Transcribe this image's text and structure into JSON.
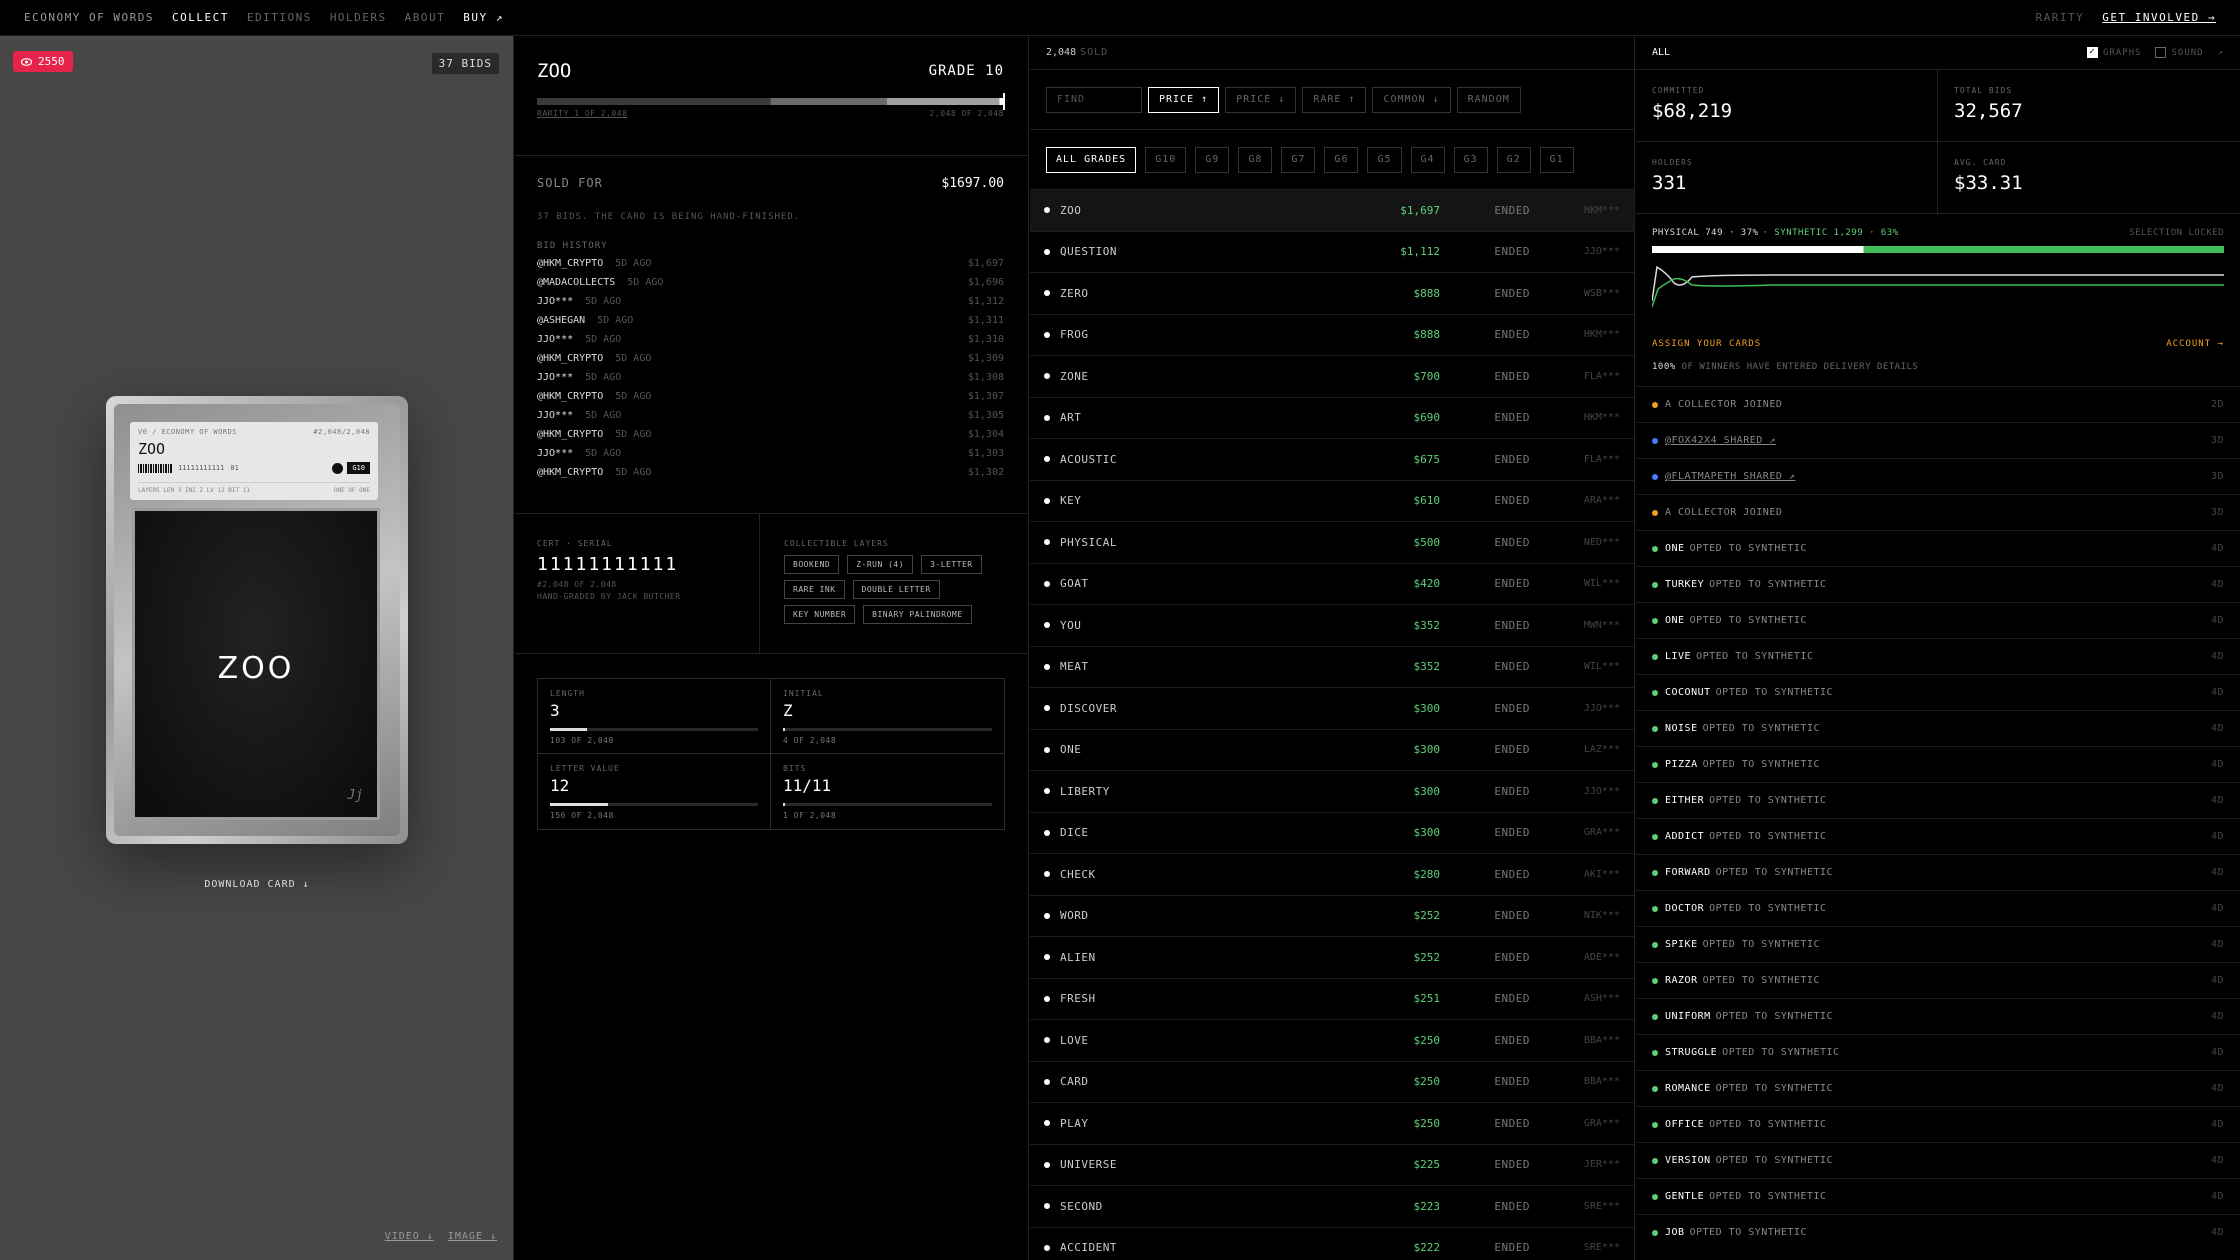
{
  "nav": {
    "brand": "ECONOMY OF WORDS",
    "items": [
      "COLLECT",
      "EDITIONS",
      "HOLDERS",
      "ABOUT"
    ],
    "buy": "BUY ↗",
    "rarity": "RARITY",
    "get_involved": "GET INVOLVED →"
  },
  "viewer": {
    "views": "2550",
    "bids": "37 BIDS",
    "download": "DOWNLOAD CARD ↓",
    "video": "VIDEO ↓",
    "image": "IMAGE ↓",
    "card": {
      "edition": "V0 / ECONOMY OF WORDS",
      "number": "#2,048/2,048",
      "word": "ZOO",
      "serial": "11111111111",
      "serial_suffix": "01",
      "grade": "G10",
      "footer_left": "LAYERS LEN 3 INI Z LV 12 BIT 11",
      "footer_right": "ONE OF ONE",
      "display_word": "ZOO",
      "signature": "Jj"
    }
  },
  "detail": {
    "word": "ZOO",
    "grade": "GRADE 10",
    "rarity": "RARITY 1 OF 2,048",
    "rarity_right": "2,048 OF 2,048",
    "sold_label": "SOLD FOR",
    "sold_value": "$1697.00",
    "desc": "37 BIDS. THE CARD IS BEING HAND-FINISHED.",
    "history_label": "BID HISTORY",
    "bids": [
      {
        "who": "@HKM_CRYPTO",
        "when": "5D AGO",
        "amt": "$1,697"
      },
      {
        "who": "@MADACOLLECTS",
        "when": "5D AGO",
        "amt": "$1,696"
      },
      {
        "who": "JJO***",
        "when": "5D AGO",
        "amt": "$1,312"
      },
      {
        "who": "@ASHEGAN",
        "when": "5D AGO",
        "amt": "$1,311"
      },
      {
        "who": "JJO***",
        "when": "5D AGO",
        "amt": "$1,310"
      },
      {
        "who": "@HKM_CRYPTO",
        "when": "5D AGO",
        "amt": "$1,309"
      },
      {
        "who": "JJO***",
        "when": "5D AGO",
        "amt": "$1,308"
      },
      {
        "who": "@HKM_CRYPTO",
        "when": "5D AGO",
        "amt": "$1,307"
      },
      {
        "who": "JJO***",
        "when": "5D AGO",
        "amt": "$1,305"
      },
      {
        "who": "@HKM_CRYPTO",
        "when": "5D AGO",
        "amt": "$1,304"
      },
      {
        "who": "JJO***",
        "when": "5D AGO",
        "amt": "$1,303"
      },
      {
        "who": "@HKM_CRYPTO",
        "when": "5D AGO",
        "amt": "$1,302"
      }
    ],
    "cert_label": "CERT · SERIAL",
    "cert": "11111111111",
    "cert_sub1": "#2,048 OF 2,048",
    "cert_sub2": "HAND-GRADED BY JACK BUTCHER",
    "layers_label": "COLLECTIBLE LAYERS",
    "layers": [
      "BOOKEND",
      "Z-RUN (4)",
      "3-LETTER",
      "RARE INK",
      "DOUBLE LETTER",
      "KEY NUMBER",
      "BINARY PALINDROME"
    ],
    "stats": [
      {
        "label": "LENGTH",
        "value": "3",
        "of": "103 OF 2,048",
        "fill": 0.18
      },
      {
        "label": "INITIAL",
        "value": "Z",
        "of": "4 OF 2,048",
        "fill": 0.01
      },
      {
        "label": "LETTER VALUE",
        "value": "12",
        "of": "156 OF 2,048",
        "fill": 0.28
      },
      {
        "label": "BITS",
        "value": "11/11",
        "of": "1 OF 2,048",
        "fill": 0.01
      }
    ]
  },
  "market": {
    "count": "2,048",
    "sold": "SOLD",
    "find": "FIND",
    "sorts": [
      "PRICE ↑",
      "PRICE ↓",
      "RARE ↑",
      "COMMON ↓",
      "RANDOM"
    ],
    "grades": [
      "ALL GRADES",
      "G10",
      "G9",
      "G8",
      "G7",
      "G6",
      "G5",
      "G4",
      "G3",
      "G2",
      "G1"
    ],
    "items": [
      {
        "w": "ZOO",
        "p": "$1,697",
        "s": "ENDED",
        "h": "HKM***"
      },
      {
        "w": "QUESTION",
        "p": "$1,112",
        "s": "ENDED",
        "h": "JJO***"
      },
      {
        "w": "ZERO",
        "p": "$888",
        "s": "ENDED",
        "h": "WSB***"
      },
      {
        "w": "FROG",
        "p": "$888",
        "s": "ENDED",
        "h": "HKM***"
      },
      {
        "w": "ZONE",
        "p": "$700",
        "s": "ENDED",
        "h": "FLA***"
      },
      {
        "w": "ART",
        "p": "$690",
        "s": "ENDED",
        "h": "HKM***"
      },
      {
        "w": "ACOUSTIC",
        "p": "$675",
        "s": "ENDED",
        "h": "FLA***"
      },
      {
        "w": "KEY",
        "p": "$610",
        "s": "ENDED",
        "h": "ARA***"
      },
      {
        "w": "PHYSICAL",
        "p": "$500",
        "s": "ENDED",
        "h": "NED***"
      },
      {
        "w": "GOAT",
        "p": "$420",
        "s": "ENDED",
        "h": "WIL***"
      },
      {
        "w": "YOU",
        "p": "$352",
        "s": "ENDED",
        "h": "MWN***"
      },
      {
        "w": "MEAT",
        "p": "$352",
        "s": "ENDED",
        "h": "WIL***"
      },
      {
        "w": "DISCOVER",
        "p": "$300",
        "s": "ENDED",
        "h": "JJO***"
      },
      {
        "w": "ONE",
        "p": "$300",
        "s": "ENDED",
        "h": "LAZ***"
      },
      {
        "w": "LIBERTY",
        "p": "$300",
        "s": "ENDED",
        "h": "JJO***"
      },
      {
        "w": "DICE",
        "p": "$300",
        "s": "ENDED",
        "h": "GRA***"
      },
      {
        "w": "CHECK",
        "p": "$280",
        "s": "ENDED",
        "h": "AKI***"
      },
      {
        "w": "WORD",
        "p": "$252",
        "s": "ENDED",
        "h": "NIK***"
      },
      {
        "w": "ALIEN",
        "p": "$252",
        "s": "ENDED",
        "h": "ADE***"
      },
      {
        "w": "FRESH",
        "p": "$251",
        "s": "ENDED",
        "h": "ASH***"
      },
      {
        "w": "LOVE",
        "p": "$250",
        "s": "ENDED",
        "h": "BBA***"
      },
      {
        "w": "CARD",
        "p": "$250",
        "s": "ENDED",
        "h": "BBA***"
      },
      {
        "w": "PLAY",
        "p": "$250",
        "s": "ENDED",
        "h": "GRA***"
      },
      {
        "w": "UNIVERSE",
        "p": "$225",
        "s": "ENDED",
        "h": "JER***"
      },
      {
        "w": "SECOND",
        "p": "$223",
        "s": "ENDED",
        "h": "SRE***"
      },
      {
        "w": "ACCIDENT",
        "p": "$222",
        "s": "ENDED",
        "h": "SRE***"
      }
    ]
  },
  "stats": {
    "all": "ALL",
    "graphs": "GRAPHS",
    "sound": "SOUND",
    "expand": "↗",
    "metrics": [
      {
        "label": "COMMITTED",
        "value": "$68,219"
      },
      {
        "label": "TOTAL BIDS",
        "value": "32,567"
      },
      {
        "label": "HOLDERS",
        "value": "331"
      },
      {
        "label": "AVG. CARD",
        "value": "$33.31"
      }
    ],
    "physical": "PHYSICAL 749 · 37%",
    "synthetic": "· SYNTHETIC 1,299 · 63%",
    "locked": "SELECTION LOCKED",
    "physical_share": 0.37,
    "assign": "ASSIGN YOUR CARDS",
    "account": "ACCOUNT →",
    "deliv_pct": "100%",
    "deliv_text": "OF WINNERS HAVE ENTERED DELIVERY DETAILS",
    "activity": [
      {
        "w": "",
        "t": "A COLLECTOR JOINED",
        "tm": "2D",
        "c": "#f0a020",
        "link": false
      },
      {
        "w": "",
        "t": "@FOX42X4 SHARED ↗",
        "tm": "3D",
        "c": "#4a7cff",
        "link": true
      },
      {
        "w": "",
        "t": "@FLATMAPETH SHARED ↗",
        "tm": "3D",
        "c": "#4a7cff",
        "link": true
      },
      {
        "w": "",
        "t": "A COLLECTOR JOINED",
        "tm": "3D",
        "c": "#f0a020",
        "link": false
      },
      {
        "w": "ONE",
        "t": "OPTED TO SYNTHETIC",
        "tm": "4D",
        "c": "#5fd07a"
      },
      {
        "w": "TURKEY",
        "t": "OPTED TO SYNTHETIC",
        "tm": "4D",
        "c": "#5fd07a"
      },
      {
        "w": "ONE",
        "t": "OPTED TO SYNTHETIC",
        "tm": "4D",
        "c": "#5fd07a"
      },
      {
        "w": "LIVE",
        "t": "OPTED TO SYNTHETIC",
        "tm": "4D",
        "c": "#5fd07a"
      },
      {
        "w": "COCONUT",
        "t": "OPTED TO SYNTHETIC",
        "tm": "4D",
        "c": "#5fd07a"
      },
      {
        "w": "NOISE",
        "t": "OPTED TO SYNTHETIC",
        "tm": "4D",
        "c": "#5fd07a"
      },
      {
        "w": "PIZZA",
        "t": "OPTED TO SYNTHETIC",
        "tm": "4D",
        "c": "#5fd07a"
      },
      {
        "w": "EITHER",
        "t": "OPTED TO SYNTHETIC",
        "tm": "4D",
        "c": "#5fd07a"
      },
      {
        "w": "ADDICT",
        "t": "OPTED TO SYNTHETIC",
        "tm": "4D",
        "c": "#5fd07a"
      },
      {
        "w": "FORWARD",
        "t": "OPTED TO SYNTHETIC",
        "tm": "4D",
        "c": "#5fd07a"
      },
      {
        "w": "DOCTOR",
        "t": "OPTED TO SYNTHETIC",
        "tm": "4D",
        "c": "#5fd07a"
      },
      {
        "w": "SPIKE",
        "t": "OPTED TO SYNTHETIC",
        "tm": "4D",
        "c": "#5fd07a"
      },
      {
        "w": "RAZOR",
        "t": "OPTED TO SYNTHETIC",
        "tm": "4D",
        "c": "#5fd07a"
      },
      {
        "w": "UNIFORM",
        "t": "OPTED TO SYNTHETIC",
        "tm": "4D",
        "c": "#5fd07a"
      },
      {
        "w": "STRUGGLE",
        "t": "OPTED TO SYNTHETIC",
        "tm": "4D",
        "c": "#5fd07a"
      },
      {
        "w": "ROMANCE",
        "t": "OPTED TO SYNTHETIC",
        "tm": "4D",
        "c": "#5fd07a"
      },
      {
        "w": "OFFICE",
        "t": "OPTED TO SYNTHETIC",
        "tm": "4D",
        "c": "#5fd07a"
      },
      {
        "w": "VERSION",
        "t": "OPTED TO SYNTHETIC",
        "tm": "4D",
        "c": "#5fd07a"
      },
      {
        "w": "GENTLE",
        "t": "OPTED TO SYNTHETIC",
        "tm": "4D",
        "c": "#5fd07a"
      },
      {
        "w": "JOB",
        "t": "OPTED TO SYNTHETIC",
        "tm": "4D",
        "c": "#5fd07a"
      }
    ]
  }
}
